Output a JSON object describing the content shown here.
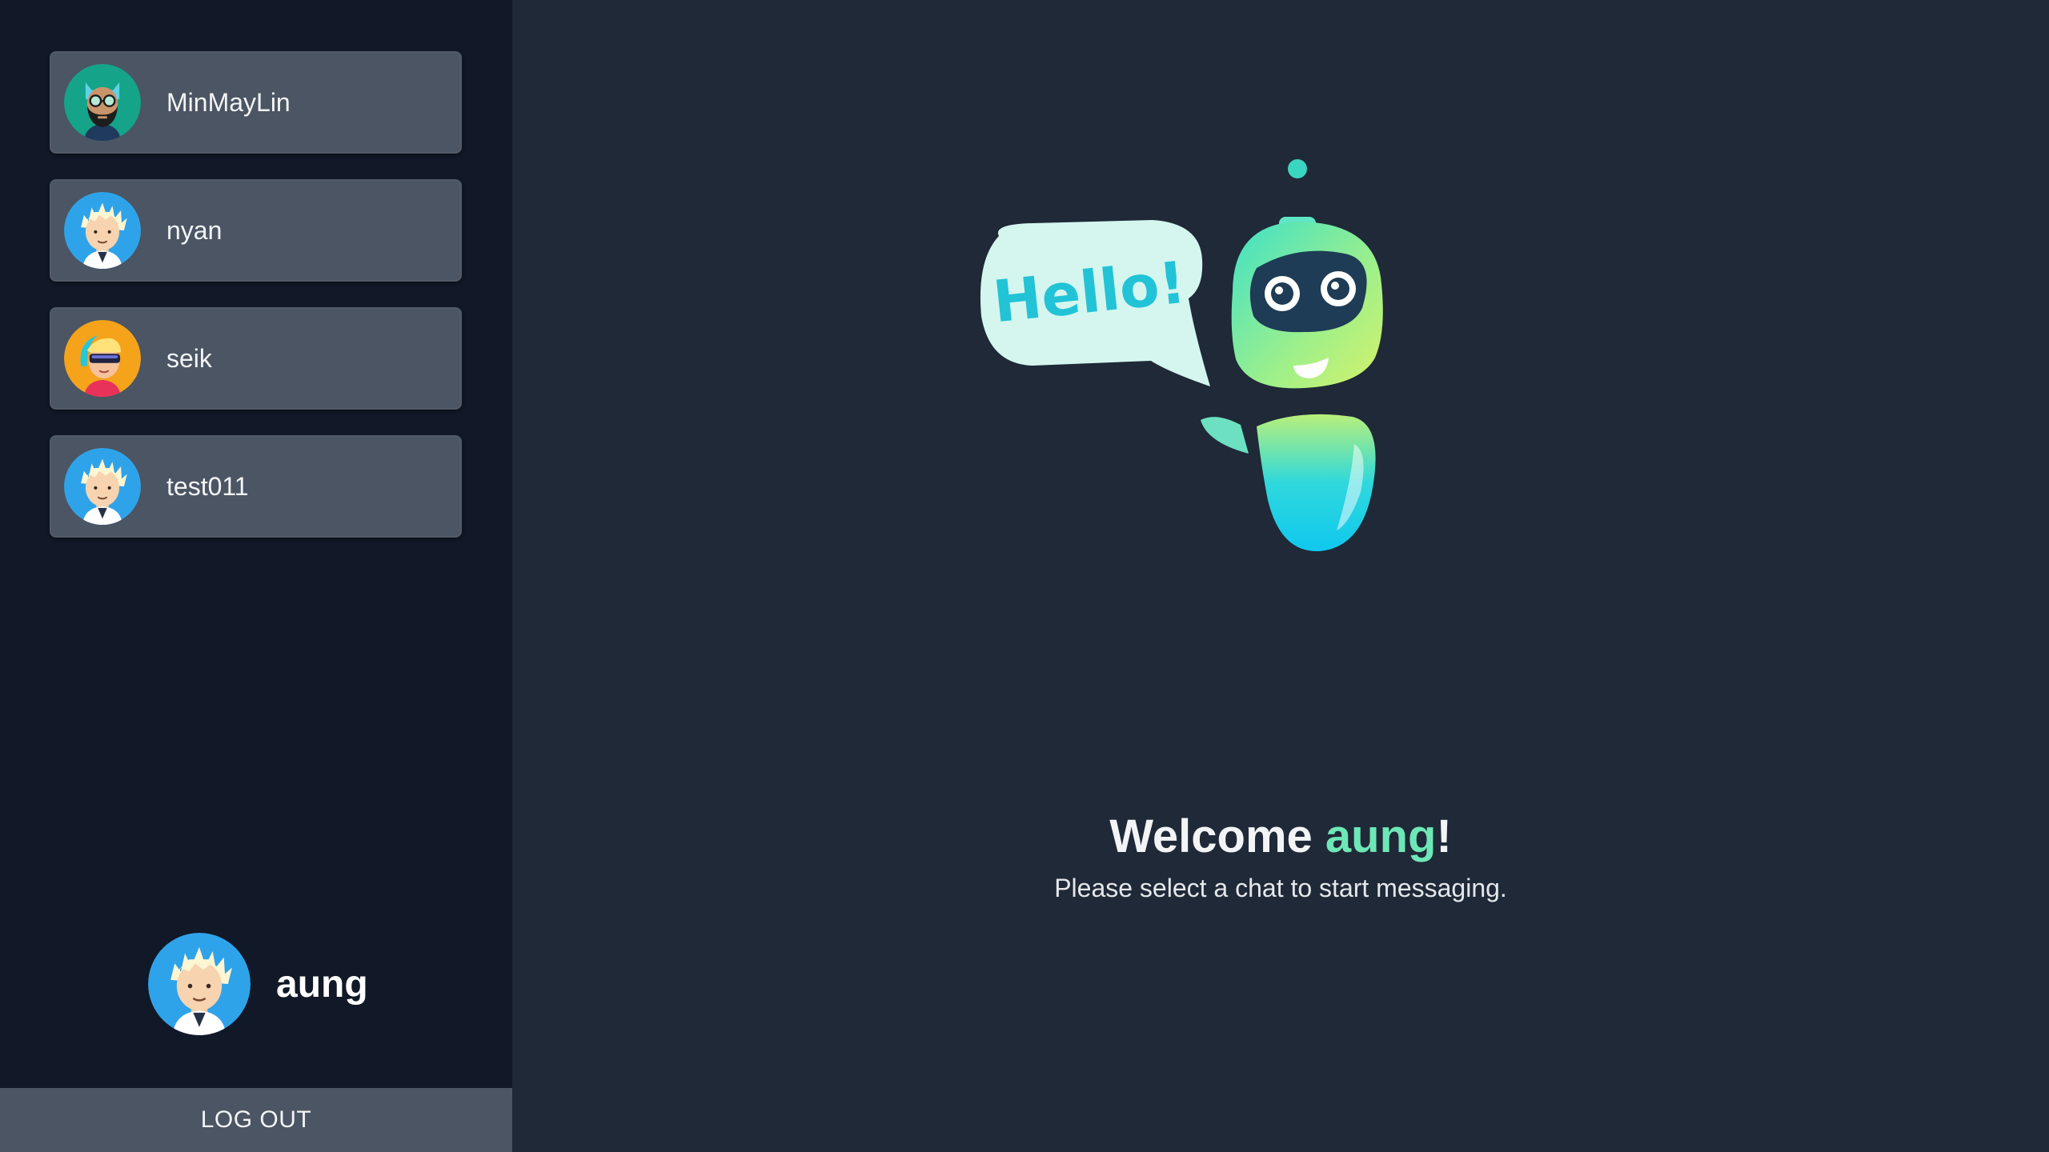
{
  "sidebar": {
    "contacts": [
      {
        "name": "MinMayLin",
        "avatar": "bearded-man-glasses-avatar"
      },
      {
        "name": "nyan",
        "avatar": "spiky-hair-boy-avatar"
      },
      {
        "name": "seik",
        "avatar": "sunglasses-girl-avatar"
      },
      {
        "name": "test011",
        "avatar": "spiky-hair-boy-avatar"
      }
    ],
    "current_user": {
      "name": "aung",
      "avatar": "spiky-hair-boy-avatar"
    },
    "logout_label": "LOG OUT"
  },
  "main": {
    "illustration": {
      "speech_text": "Hello!",
      "icon": "robot-icon"
    },
    "welcome_prefix": "Welcome ",
    "welcome_name": "aung",
    "welcome_suffix": "!",
    "subtitle": "Please select a chat to start messaging."
  },
  "colors": {
    "sidebar_bg": "#111827",
    "main_bg": "#1f2937",
    "card_bg": "#4b5563",
    "accent": "#6ee7b7"
  }
}
